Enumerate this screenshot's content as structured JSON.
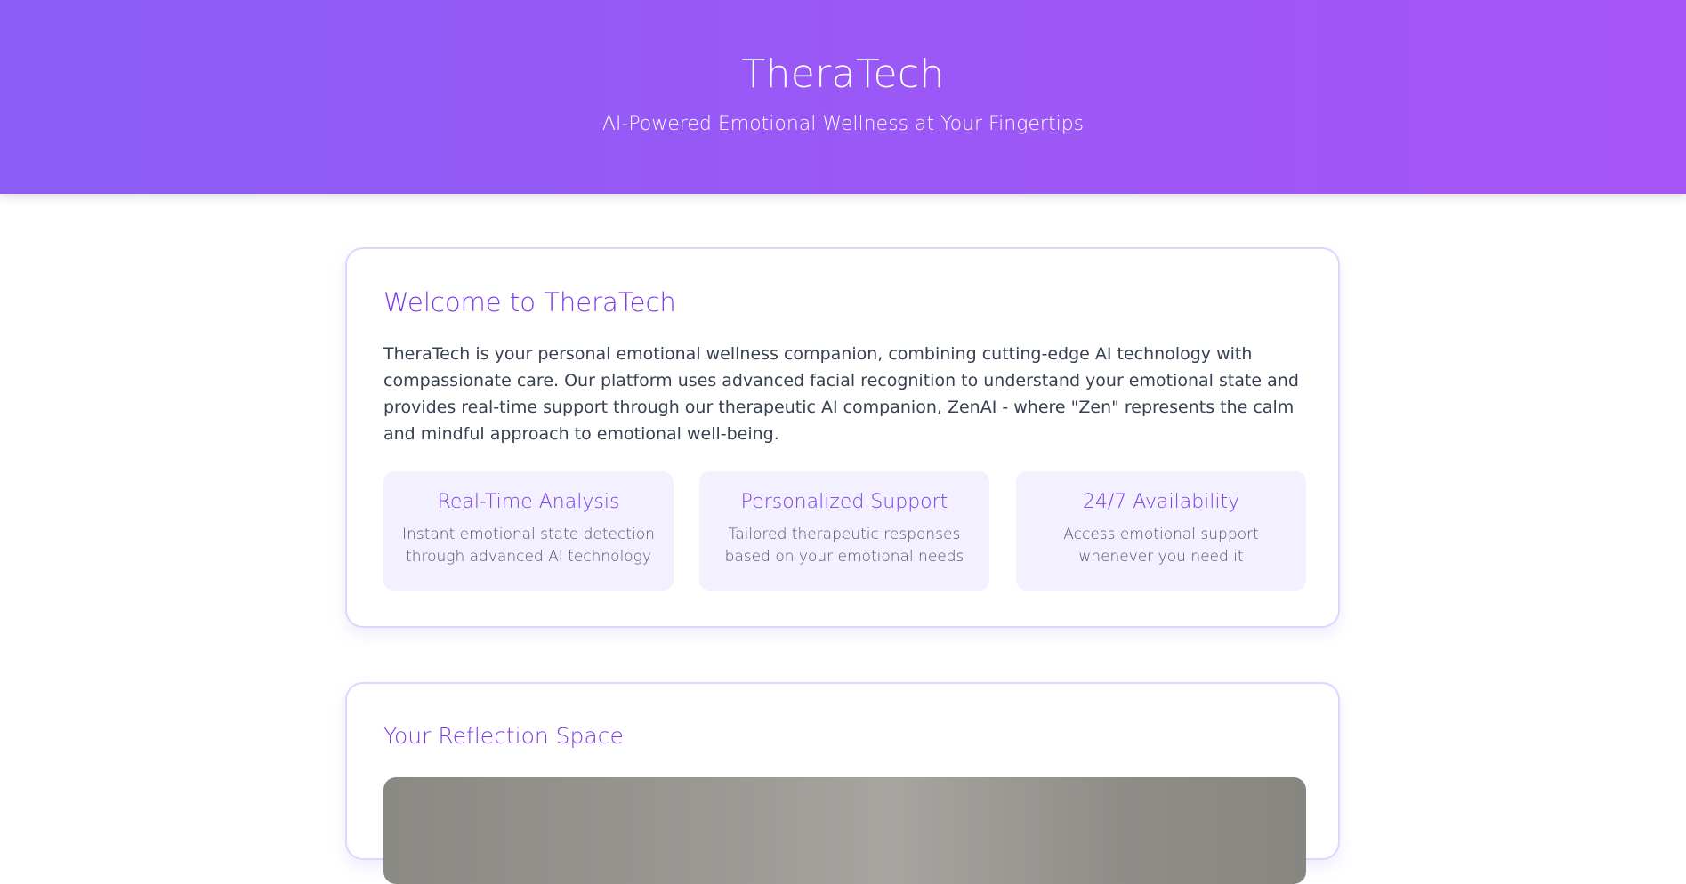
{
  "header": {
    "title": "TheraTech",
    "subtitle": "AI-Powered Emotional Wellness at Your Fingertips"
  },
  "welcome": {
    "title": "Welcome to TheraTech",
    "intro": "TheraTech is your personal emotional wellness companion, combining cutting-edge AI technology with compassionate care. Our platform uses advanced facial recognition to understand your emotional state and provides real-time support through our therapeutic AI companion, ZenAI - where \"Zen\" represents the calm and mindful approach to emotional well-being.",
    "features": [
      {
        "title": "Real-Time Analysis",
        "description": "Instant emotional state detection through advanced AI technology"
      },
      {
        "title": "Personalized Support",
        "description": "Tailored therapeutic responses based on your emotional needs"
      },
      {
        "title": "24/7 Availability",
        "description": "Access emotional support whenever you need it"
      }
    ]
  },
  "reflection": {
    "title": "Your Reflection Space"
  },
  "colors": {
    "accent": "#8b5cf6",
    "accent_dark": "#7c3aed",
    "feature_bg": "#f3f0ff",
    "card_border": "#ddd6fe"
  }
}
